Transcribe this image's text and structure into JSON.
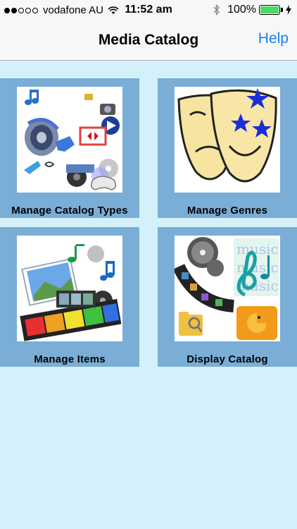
{
  "status_bar": {
    "carrier": "vodafone AU",
    "time": "11:52 am",
    "battery": "100%",
    "signal_bars_filled": 2,
    "signal_bars_total": 5
  },
  "nav": {
    "title": "Media Catalog",
    "help_label": "Help"
  },
  "tiles": [
    {
      "label": "Manage Catalog Types"
    },
    {
      "label": "Manage Genres"
    },
    {
      "label": "Manage Items"
    },
    {
      "label": "Display Catalog"
    }
  ],
  "colors": {
    "background": "#d4f1fb",
    "tile": "#7aaed6",
    "accent": "#1a7ef2",
    "battery": "#4cd964"
  }
}
